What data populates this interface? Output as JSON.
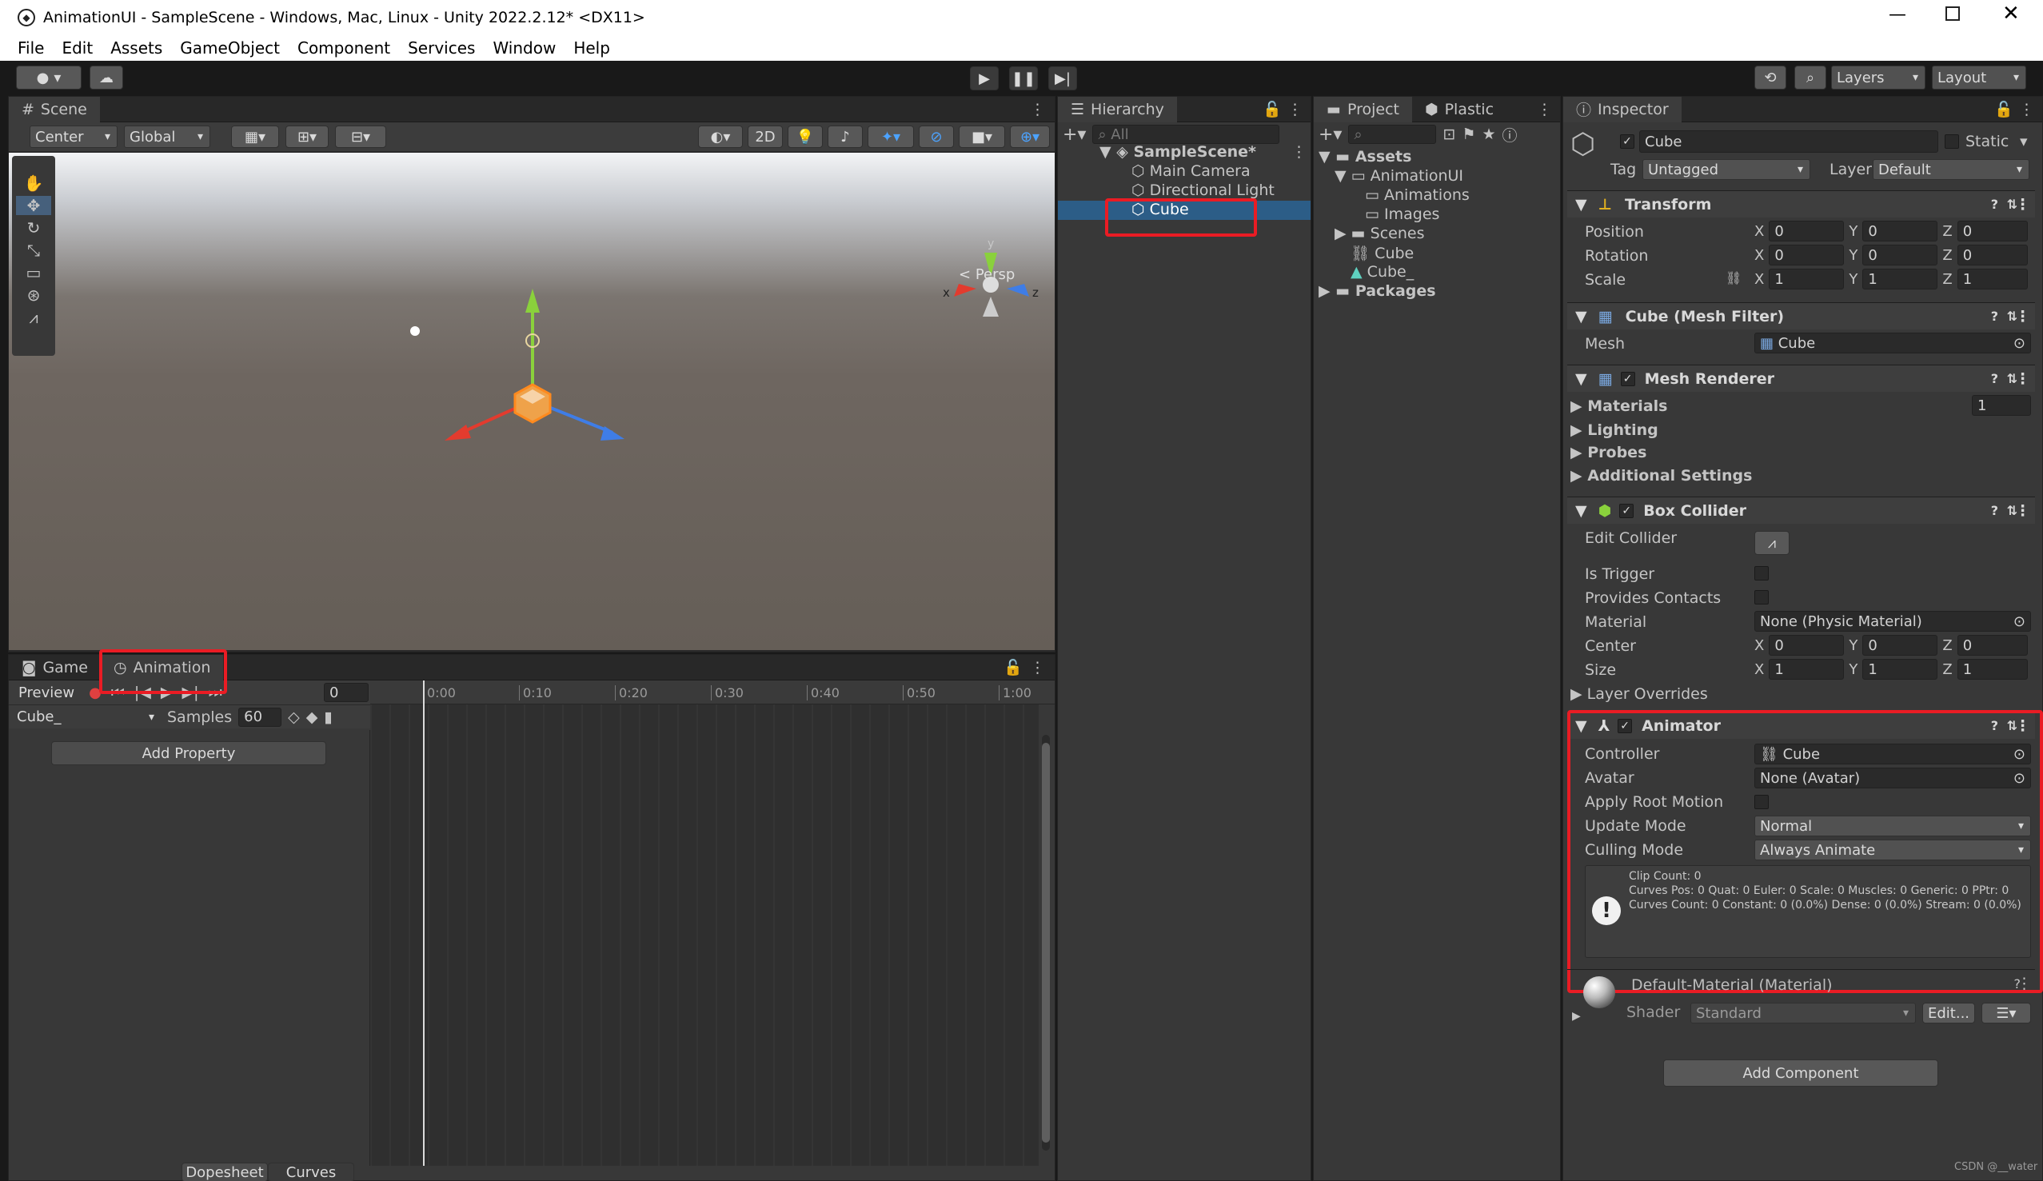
{
  "window": {
    "title": "AnimationUI - SampleScene - Windows, Mac, Linux - Unity 2022.2.12* <DX11>"
  },
  "menu": [
    "File",
    "Edit",
    "Assets",
    "GameObject",
    "Component",
    "Services",
    "Window",
    "Help"
  ],
  "toolbar": {
    "layers_label": "Layers",
    "layout_label": "Layout"
  },
  "scene": {
    "tab": "Scene",
    "pivot": "Center",
    "space": "Global",
    "mode_2d": "2D",
    "persp_label": "Persp",
    "gizmo_x": "x",
    "gizmo_y": "y",
    "gizmo_z": "z"
  },
  "hierarchy": {
    "tab": "Hierarchy",
    "search_placeholder": "All",
    "scene_name": "SampleScene*",
    "items": [
      "Main Camera",
      "Directional Light",
      "Cube"
    ]
  },
  "project": {
    "tab": "Project",
    "plastic_tab": "Plastic",
    "tree": {
      "assets": "Assets",
      "animation_ui": "AnimationUI",
      "animations": "Animations",
      "images": "Images",
      "scenes": "Scenes",
      "cube": "Cube",
      "cube_": "Cube_",
      "packages": "Packages"
    }
  },
  "animation": {
    "tab_game": "Game",
    "tab_animation": "Animation",
    "preview_label": "Preview",
    "frame": "0",
    "clip": "Cube_",
    "samples_label": "Samples",
    "samples": "60",
    "add_property": "Add Property",
    "timeline_ticks": [
      "0:00",
      "0:10",
      "0:20",
      "0:30",
      "0:40",
      "0:50",
      "1:00"
    ],
    "bottom_tabs": [
      "Dopesheet",
      "Curves"
    ]
  },
  "inspector": {
    "tab": "Inspector",
    "object_name": "Cube",
    "static_label": "Static",
    "tag_label": "Tag",
    "tag_value": "Untagged",
    "layer_label": "Layer",
    "layer_value": "Default",
    "transform": {
      "title": "Transform",
      "position_label": "Position",
      "rotation_label": "Rotation",
      "scale_label": "Scale",
      "position": [
        "0",
        "0",
        "0"
      ],
      "rotation": [
        "0",
        "0",
        "0"
      ],
      "scale": [
        "1",
        "1",
        "1"
      ]
    },
    "mesh_filter": {
      "title": "Cube (Mesh Filter)",
      "mesh_label": "Mesh",
      "mesh_value": "Cube"
    },
    "mesh_renderer": {
      "title": "Mesh Renderer",
      "materials": "Materials",
      "materials_count": "1",
      "lighting": "Lighting",
      "probes": "Probes",
      "additional": "Additional Settings"
    },
    "box_collider": {
      "title": "Box Collider",
      "edit_collider": "Edit Collider",
      "is_trigger": "Is Trigger",
      "provides_contacts": "Provides Contacts",
      "material_label": "Material",
      "material_value": "None (Physic Material)",
      "center_label": "Center",
      "size_label": "Size",
      "center": [
        "0",
        "0",
        "0"
      ],
      "size": [
        "1",
        "1",
        "1"
      ],
      "layer_overrides": "Layer Overrides"
    },
    "animator": {
      "title": "Animator",
      "controller_label": "Controller",
      "controller_value": "Cube",
      "avatar_label": "Avatar",
      "avatar_value": "None (Avatar)",
      "root_motion_label": "Apply Root Motion",
      "update_mode_label": "Update Mode",
      "update_mode_value": "Normal",
      "culling_label": "Culling Mode",
      "culling_value": "Always Animate",
      "info_line1": "Clip Count: 0",
      "info_line2": "Curves Pos: 0 Quat: 0 Euler: 0 Scale: 0 Muscles: 0 Generic: 0 PPtr: 0",
      "info_line3": "Curves Count: 0 Constant: 0 (0.0%) Dense: 0 (0.0%) Stream: 0 (0.0%)"
    },
    "material": {
      "title": "Default-Material (Material)",
      "shader_label": "Shader",
      "shader_value": "Standard",
      "edit_button": "Edit..."
    },
    "add_component": "Add Component"
  },
  "watermark": "CSDN @__water",
  "axis_labels": {
    "x": "X",
    "y": "Y",
    "z": "Z"
  }
}
